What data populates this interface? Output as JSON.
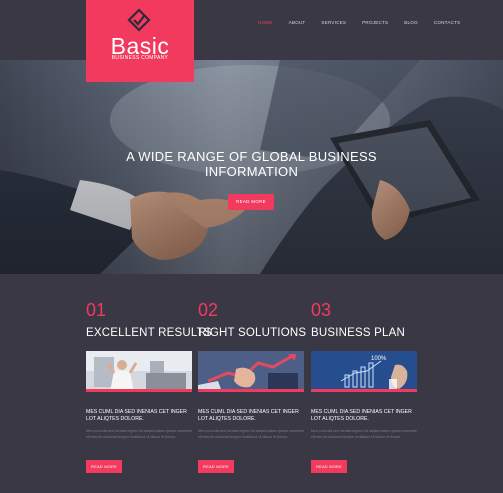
{
  "logo": {
    "title": "Basic",
    "subtitle": "BUSINESS COMPANY",
    "icon": "diamond-check-icon"
  },
  "nav": {
    "items": [
      "HOME",
      "ABOUT",
      "SERVICES",
      "PROJECTS",
      "BLOG",
      "CONTACTS"
    ],
    "active": "HOME"
  },
  "hero": {
    "title_line1": "A WIDE RANGE OF GLOBAL BUSINESS",
    "title_line2": "INFORMATION",
    "button": "READ MORE"
  },
  "columns": [
    {
      "number": "01",
      "title": "EXCELLENT RESULTS",
      "heading": "MES CUML DIA SED INENIAS CET INGER LOT ALIQTES DOLORE.",
      "body": "Mes cuml dia sed inenias ingerto lot aliqtes dolore ipsum commete elit sed do eiusmod tempor incididunt ut labore et dolore.",
      "button": "READ MORE"
    },
    {
      "number": "02",
      "title": "RIGHT SOLUTIONS",
      "heading": "MES CUML DIA SED INENIAS CET INGER LOT ALIQTES DOLORE.",
      "body": "Mes cuml dia sed inenias ingerto lot aliqtes dolore ipsum commete elit sed do eiusmod tempor incididunt ut labore et dolore.",
      "button": "READ MORE"
    },
    {
      "number": "03",
      "title": "BUSINESS PLAN",
      "heading": "MES CUML DIA SED INENIAS CET INGER LOT ALIQTES DOLORE.",
      "body": "Mes cuml dia sed inenias ingerto lot aliqtes dolore ipsum commete elit sed do eiusmod tempor incididunt ut labore et dolore.",
      "button": "READ MORE"
    }
  ],
  "image3_label": "100%",
  "colors": {
    "accent": "#f23a5f",
    "background": "#3a3845",
    "text_muted": "#7f7c88"
  }
}
